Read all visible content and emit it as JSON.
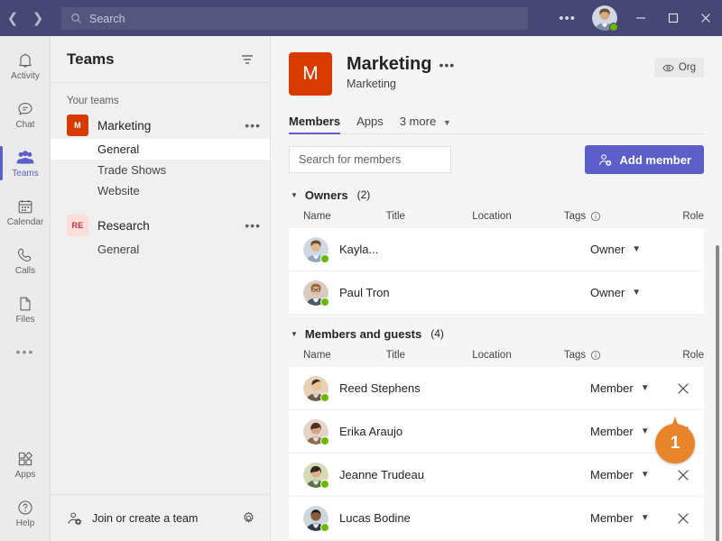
{
  "titlebar": {
    "back_icon": "chevron-left-icon",
    "forward_icon": "chevron-right-icon",
    "search_placeholder": "Search",
    "more_label": "•••",
    "minimize_label": "Minimize",
    "maximize_label": "Maximize",
    "close_label": "Close",
    "bg_color": "#464775",
    "search_bg_color": "#55567d"
  },
  "rail": {
    "items": [
      {
        "label": "Activity",
        "icon": "bell-icon",
        "active": false
      },
      {
        "label": "Chat",
        "icon": "chat-icon",
        "active": false
      },
      {
        "label": "Teams",
        "icon": "teams-icon",
        "active": true
      },
      {
        "label": "Calendar",
        "icon": "calendar-icon",
        "active": false
      },
      {
        "label": "Calls",
        "icon": "phone-icon",
        "active": false
      },
      {
        "label": "Files",
        "icon": "file-icon",
        "active": false
      }
    ],
    "more_label": "•••",
    "bottom_items": [
      {
        "label": "Apps",
        "icon": "apps-icon"
      },
      {
        "label": "Help",
        "icon": "help-icon"
      }
    ],
    "accent_color": "#5b5fc7"
  },
  "teams_panel": {
    "title": "Teams",
    "filter_icon": "filter-icon",
    "section_label": "Your teams",
    "teams": [
      {
        "name": "Marketing",
        "avatar_initials": "M",
        "avatar_color": "#d83b01",
        "avatar_text_color": "#ffffff",
        "more_label": "•••",
        "channels": [
          {
            "name": "General",
            "selected": true
          },
          {
            "name": "Trade Shows",
            "selected": false
          },
          {
            "name": "Website",
            "selected": false
          }
        ]
      },
      {
        "name": "Research",
        "avatar_initials": "RE",
        "avatar_color": "#fbded7",
        "avatar_text_color": "#c4314b",
        "more_label": "•••",
        "channels": [
          {
            "name": "General",
            "selected": false
          }
        ]
      }
    ],
    "footer": {
      "label": "Join or create a team",
      "icon": "add-team-icon",
      "settings_icon": "gear-icon"
    }
  },
  "main": {
    "team_avatar_initials": "M",
    "team_avatar_color": "#d83b01",
    "title": "Marketing",
    "title_more_label": "•••",
    "subtitle": "Marketing",
    "org_badge": {
      "label": "Org",
      "icon": "eye-icon"
    },
    "tabs": [
      {
        "label": "Members",
        "active": true
      },
      {
        "label": "Apps",
        "active": false
      },
      {
        "label": "3 more",
        "active": false,
        "has_chevron": true
      }
    ],
    "search": {
      "value": "",
      "placeholder": "Search for members",
      "icon": "search-icon"
    },
    "add_member": {
      "label": "Add member",
      "icon": "add-person-icon",
      "color": "#5b5fc7"
    },
    "columns": {
      "name": "Name",
      "title": "Title",
      "location": "Location",
      "tags": "Tags",
      "tags_info_icon": "info-icon",
      "role": "Role"
    },
    "groups": [
      {
        "title": "Owners",
        "count": "(2)",
        "expanded": true,
        "rows": [
          {
            "name": "Kayla...",
            "title": "",
            "location": "",
            "tags": "",
            "role": "Owner",
            "removable": false,
            "presence": "available",
            "avatar_colors": [
              "#cfd8e3",
              "#8fa6c4"
            ]
          },
          {
            "name": "Paul Tron",
            "title": "",
            "location": "",
            "tags": "",
            "role": "Owner",
            "removable": false,
            "presence": "available",
            "avatar_colors": [
              "#d9cbbd",
              "#9b7e62"
            ]
          }
        ]
      },
      {
        "title": "Members and guests",
        "count": "(4)",
        "expanded": true,
        "rows": [
          {
            "name": "Reed Stephens",
            "title": "",
            "location": "",
            "tags": "",
            "role": "Member",
            "removable": true,
            "presence": "available",
            "avatar_colors": [
              "#e7d2b8",
              "#6b5a48"
            ]
          },
          {
            "name": "Erika Araujo",
            "title": "",
            "location": "",
            "tags": "",
            "role": "Member",
            "removable": true,
            "presence": "available",
            "avatar_colors": [
              "#e4d3c6",
              "#8e6a55"
            ]
          },
          {
            "name": "Jeanne Trudeau",
            "title": "",
            "location": "",
            "tags": "",
            "role": "Member",
            "removable": true,
            "presence": "available",
            "avatar_colors": [
              "#d6d9b5",
              "#5d7245"
            ]
          },
          {
            "name": "Lucas Bodine",
            "title": "",
            "location": "",
            "tags": "",
            "role": "Member",
            "removable": true,
            "presence": "available",
            "avatar_colors": [
              "#cfd6de",
              "#3c4a5c"
            ]
          }
        ]
      }
    ],
    "role_chevron_icon": "chevron-down-icon",
    "remove_icon": "close-icon"
  },
  "annotation": {
    "number": "1",
    "color": "#e8842a"
  }
}
